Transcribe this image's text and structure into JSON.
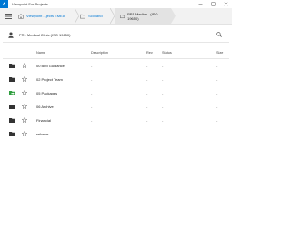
{
  "window": {
    "title": "Viewpoint For Projects",
    "accent": "#0078d4"
  },
  "breadcrumbs": [
    {
      "label": "Viewpoint ...jects EMEA",
      "icon": "building-icon"
    },
    {
      "label": "Scotland",
      "icon": "folder-icon"
    },
    {
      "label": "PR1 Medica...(ISO 19650)",
      "icon": "folder-icon"
    }
  ],
  "search": {
    "context": "PR1 Medical Clinic (ISO 19650)"
  },
  "table": {
    "columns": {
      "name": "Name",
      "description": "Description",
      "rev": "Rev",
      "status": "Status",
      "size": "Size"
    },
    "rows": [
      {
        "name": "00 BIM Guidance",
        "description": "-",
        "rev": "-",
        "status": "-",
        "size": "-",
        "folder_color": "#333333"
      },
      {
        "name": "02 Project Team",
        "description": "-",
        "rev": "-",
        "status": "-",
        "size": "-",
        "folder_color": "#333333"
      },
      {
        "name": "05 Packages",
        "description": "-",
        "rev": "-",
        "status": "-",
        "size": "-",
        "folder_color": "#2e9e3e"
      },
      {
        "name": "06 Archive",
        "description": "-",
        "rev": "-",
        "status": "-",
        "size": "-",
        "folder_color": "#333333"
      },
      {
        "name": "Financial",
        "description": "-",
        "rev": "-",
        "status": "-",
        "size": "-",
        "folder_color": "#333333"
      },
      {
        "name": "reforms",
        "description": "-",
        "rev": "-",
        "status": "-",
        "size": "-",
        "folder_color": "#333333"
      }
    ]
  }
}
